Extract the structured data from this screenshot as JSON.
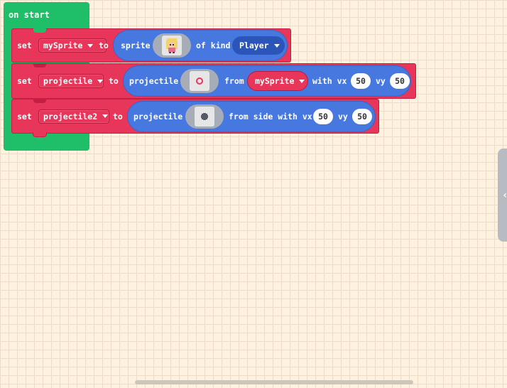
{
  "event": {
    "label": "on start"
  },
  "blocks": [
    {
      "set": "set",
      "variable": "mySprite",
      "to": "to",
      "expr_label": "sprite",
      "of_kind": "of kind",
      "kind": "Player"
    },
    {
      "set": "set",
      "variable": "projectile",
      "to": "to",
      "expr_label": "projectile",
      "from": "from",
      "source": "mySprite",
      "with_vx": "with vx",
      "vx": "50",
      "vy_label": "vy",
      "vy": "50"
    },
    {
      "set": "set",
      "variable": "projectile2",
      "to": "to",
      "expr_label": "projectile",
      "from_side": "from side with vx",
      "vx": "50",
      "vy_label": "vy",
      "vy": "50"
    }
  ],
  "colors": {
    "event_green": "#1fbf6a",
    "variables_red": "#e8365a",
    "sprites_blue": "#4778e0"
  }
}
